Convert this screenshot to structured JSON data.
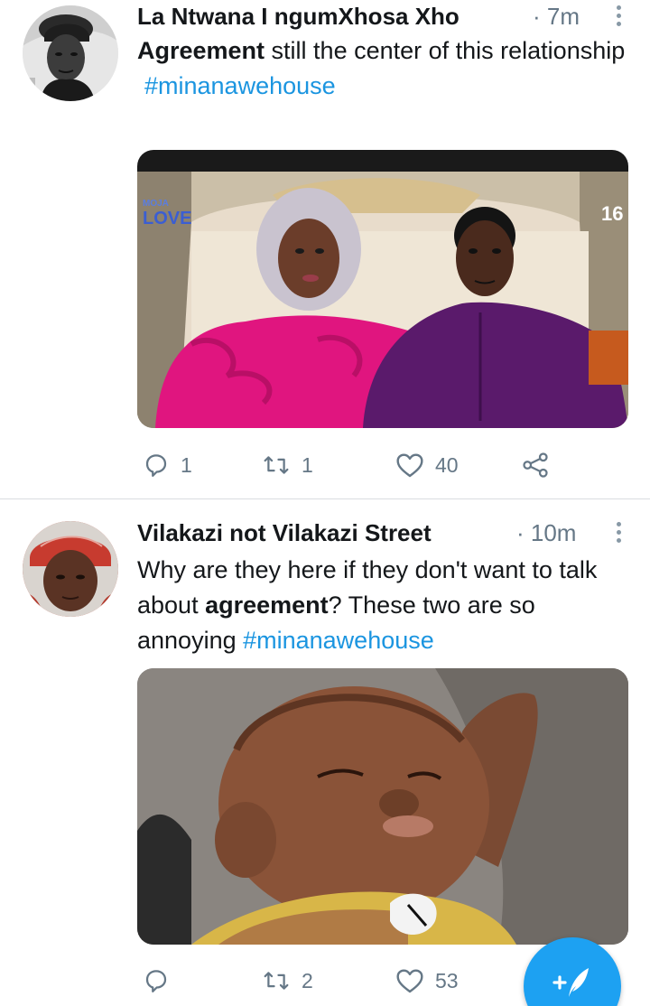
{
  "tweets": [
    {
      "author": "La Ntwana I ngumXhosa Xho",
      "time": "· 7m",
      "text_bold": "Agreement",
      "text_rest": " still the center of this relationship",
      "hashtag": "#minanawehouse",
      "media_overlay": {
        "logo_line1": "MOJA",
        "logo_line2": "LOVE",
        "rating": "16"
      },
      "actions": {
        "replies": "1",
        "retweets": "1",
        "likes": "40"
      }
    },
    {
      "author": "Vilakazi not Vilakazi Street",
      "time": "· 10m",
      "text_before": "Why are they here if they don't want to talk about ",
      "text_bold": "agreement",
      "text_after": "? These two are so annoying ",
      "hashtag": "#minanawehouse",
      "actions": {
        "replies": "",
        "retweets": "2",
        "likes": "53"
      }
    }
  ],
  "icons": {
    "reply": "reply-icon",
    "retweet": "retweet-icon",
    "like": "heart-icon",
    "share": "share-icon",
    "more": "more-vertical-icon",
    "compose": "compose-tweet-icon"
  },
  "colors": {
    "link": "#1b95e0",
    "meta": "#657786",
    "fab": "#1da1f2",
    "pink_dress": "#e0157f",
    "purple_shirt": "#5a1a6b"
  }
}
